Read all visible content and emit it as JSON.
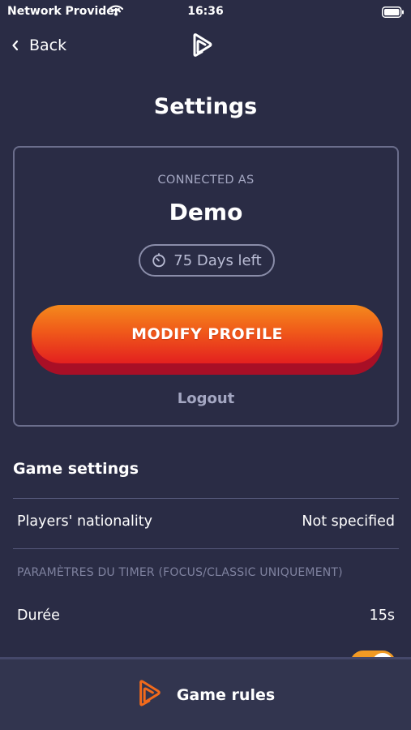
{
  "status_bar": {
    "carrier": "Network Provider",
    "time": "16:36",
    "wifi_icon": "wifi-icon",
    "battery_icon": "battery-icon"
  },
  "nav": {
    "back_label": "Back",
    "back_icon": "chevron-left-icon",
    "logo_icon": "app-logo-icon"
  },
  "page": {
    "title": "Settings"
  },
  "profile": {
    "connected_label": "CONNECTED AS",
    "username": "Demo",
    "days_left": "75 Days left",
    "timer_icon": "timer-icon",
    "modify_label": "MODIFY PROFILE",
    "logout_label": "Logout"
  },
  "game_settings": {
    "title": "Game settings",
    "nationality_label": "Players' nationality",
    "nationality_value": "Not specified",
    "timer_section_label": "PARAMÈTRES DU TIMER (FOCUS/CLASSIC UNIQUEMENT)",
    "duration_label": "Durée",
    "duration_value": "15s"
  },
  "bottom_bar": {
    "label": "Game rules",
    "icon": "game-rules-icon"
  },
  "colors": {
    "background": "#2a2c45",
    "accent_orange": "#f48a1c",
    "accent_red": "#e3201f",
    "muted_text": "#a4a7c2"
  }
}
